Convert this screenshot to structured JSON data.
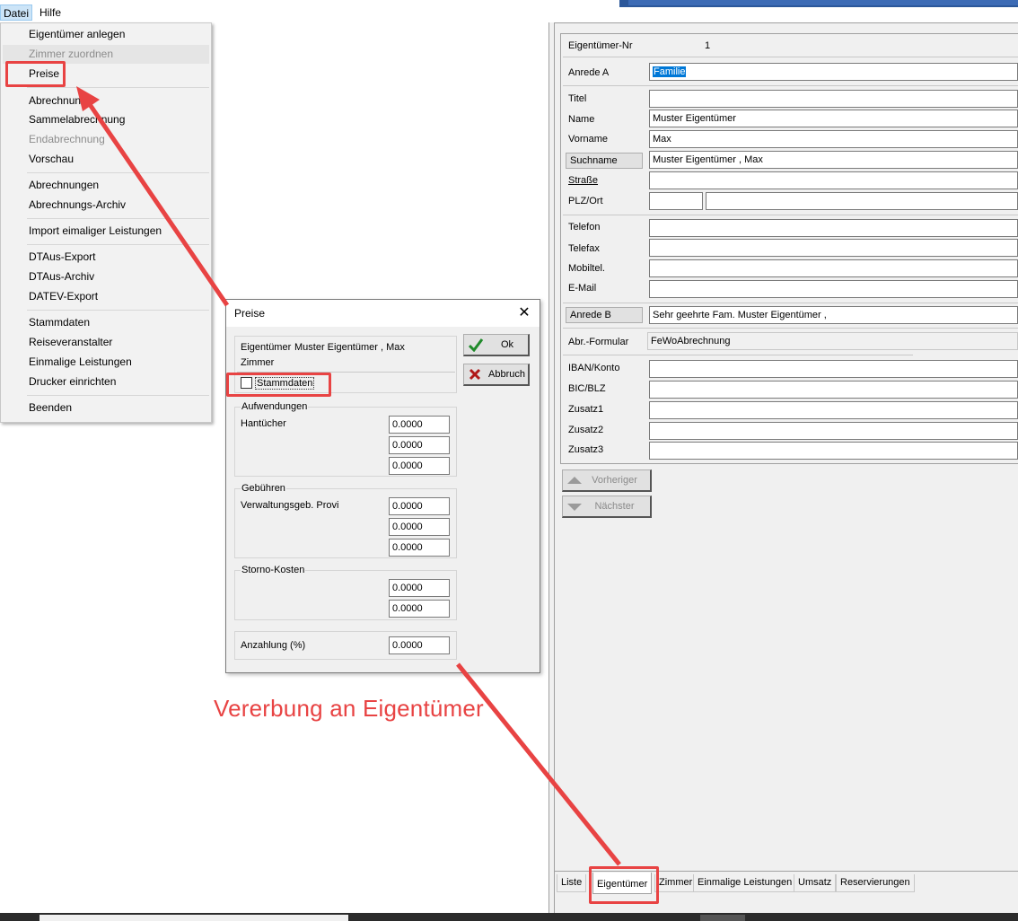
{
  "menubar": {
    "datei": "Datei",
    "hilfe": "Hilfe"
  },
  "menu": {
    "eigentuemer_anlegen": "Eigentümer anlegen",
    "zimmer_zuordnen": "Zimmer zuordnen",
    "preise": "Preise",
    "abrechnung": "Abrechnung",
    "sammelabrechnung": "Sammelabrechnung",
    "endabrechnung": "Endabrechnung",
    "vorschau": "Vorschau",
    "abrechnungen": "Abrechnungen",
    "abrechnungs_archiv": "Abrechnungs-Archiv",
    "import_leistungen": "Import eimaliger Leistungen",
    "dtaus_export": "DTAus-Export",
    "dtaus_archiv": "DTAus-Archiv",
    "datev_export": "DATEV-Export",
    "stammdaten": "Stammdaten",
    "reiseveranstalter": "Reiseveranstalter",
    "einmalige_leistungen": "Einmalige Leistungen",
    "drucker_einrichten": "Drucker einrichten",
    "beenden": "Beenden"
  },
  "dialog": {
    "title": "Preise",
    "close": "✕",
    "eigentuemer_label": "Eigentümer",
    "eigentuemer_value": "Muster Eigentümer , Max",
    "zimmer_label": "Zimmer",
    "stammdaten": "Stammdaten",
    "ok": "Ok",
    "abbruch": "Abbruch",
    "aufwendungen": "Aufwendungen",
    "hantuecher": "Hantücher",
    "aufw_values": [
      "0.0000",
      "0.0000",
      "0.0000"
    ],
    "gebuehren": "Gebühren",
    "verwaltungsgeb": "Verwaltungsgeb. Provi",
    "geb_values": [
      "0.0000",
      "0.0000",
      "0.0000"
    ],
    "storno": "Storno-Kosten",
    "storno_values": [
      "0.0000",
      "0.0000"
    ],
    "anzahlung": "Anzahlung (%)",
    "anzahlung_value": "0.0000"
  },
  "form": {
    "eigentuemer_nr_label": "Eigentümer-Nr",
    "eigentuemer_nr_value": "1",
    "anrede_a_label": "Anrede A",
    "anrede_a_value": "Familie",
    "titel_label": "Titel",
    "titel_value": "",
    "name_label": "Name",
    "name_value": "Muster Eigentümer",
    "vorname_label": "Vorname",
    "vorname_value": "Max",
    "suchname_label": "Suchname",
    "suchname_value": "Muster Eigentümer , Max",
    "strasse_label": "Straße",
    "plz_label": "PLZ/Ort",
    "telefon_label": "Telefon",
    "telefax_label": "Telefax",
    "mobil_label": "Mobiltel.",
    "email_label": "E-Mail",
    "anrede_b_label": "Anrede B",
    "anrede_b_value": "Sehr geehrte Fam. Muster Eigentümer ,",
    "abr_formular_label": "Abr.-Formular",
    "abr_formular_value": "FeWoAbrechnung",
    "iban_label": "IBAN/Konto",
    "bic_label": "BIC/BLZ",
    "zusatz1_label": "Zusatz1",
    "zusatz2_label": "Zusatz2",
    "zusatz3_label": "Zusatz3",
    "vorheriger": "Vorheriger",
    "naechster": "Nächster"
  },
  "tabs": [
    "Liste",
    "Eigentümer",
    "Zimmer",
    "Einmalige Leistungen",
    "Umsatz",
    "Reservierungen"
  ],
  "annotation": {
    "text": "Vererbung an Eigentümer"
  },
  "colors": {
    "annotation_red": "#e84343",
    "selection_blue": "#0078d7"
  }
}
